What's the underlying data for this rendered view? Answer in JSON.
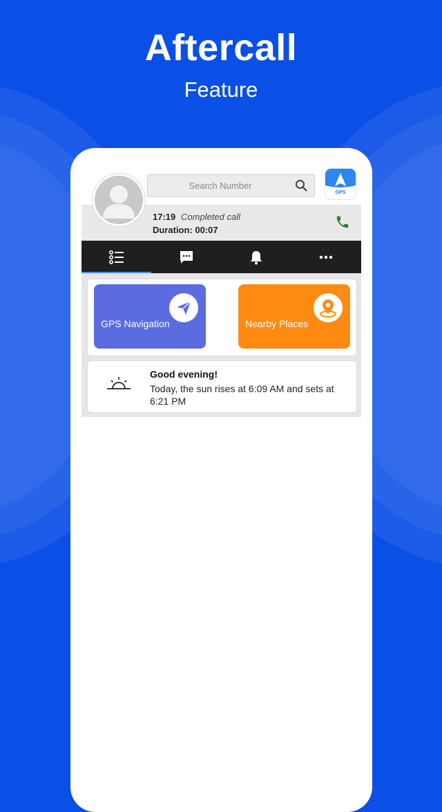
{
  "promo": {
    "headline": "Aftercall",
    "subheadline": "Feature"
  },
  "colors": {
    "background": "#0a4fe6",
    "gps_card": "#5b6be0",
    "nearby_card": "#ff8a12",
    "call_icon": "#2e7d32",
    "tab_bar": "#1f1f1f"
  },
  "caller": {
    "avatar_icon": "person-avatar-icon",
    "time": "17:19",
    "status": "Completed call",
    "duration": "Duration: 00:07"
  },
  "search": {
    "placeholder": "Search Number",
    "icon": "search-icon"
  },
  "app_logo": {
    "text": "GPS"
  },
  "tabs": [
    {
      "icon": "list-icon",
      "active": true
    },
    {
      "icon": "message-icon",
      "active": false
    },
    {
      "icon": "bell-icon",
      "active": false
    },
    {
      "icon": "more-icon",
      "active": false
    }
  ],
  "features": [
    {
      "label": "GPS Navigation",
      "icon": "send-arrow-icon"
    },
    {
      "label": "Nearby Places",
      "icon": "location-pin-icon"
    }
  ],
  "greeting": {
    "title": "Good evening!",
    "text": "Today, the sun rises at 6:09 AM and sets at 6:21 PM",
    "icon": "sunrise-icon"
  }
}
